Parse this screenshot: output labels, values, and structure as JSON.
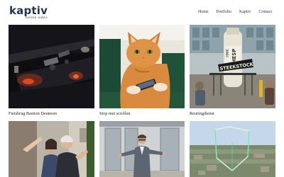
{
  "brand": {
    "name": "kaptiv",
    "tagline": "online video"
  },
  "nav": {
    "items": [
      {
        "label": "Home"
      },
      {
        "label": "Portfolio"
      },
      {
        "label": "Kaptiv"
      },
      {
        "label": "Contact"
      }
    ]
  },
  "portfolio": {
    "items": [
      {
        "title": "Fietsbrug Bastion Deuteren",
        "thumbnail": "night-bridge-cyclists"
      },
      {
        "title": "Stop met scrollen",
        "thumbnail": "cat-with-phone"
      },
      {
        "title": "Reuringdienst",
        "thumbnail": "bottle-sign-building"
      },
      {
        "title": "",
        "thumbnail": "couple-street"
      },
      {
        "title": "",
        "thumbnail": "man-presenting"
      },
      {
        "title": "",
        "thumbnail": "aerial-city-shape"
      }
    ]
  },
  "images": {
    "bottle_sign": "STEEKSTOCK",
    "bottle_label_1": "HESP",
    "bottle_label_2": "HMK"
  }
}
